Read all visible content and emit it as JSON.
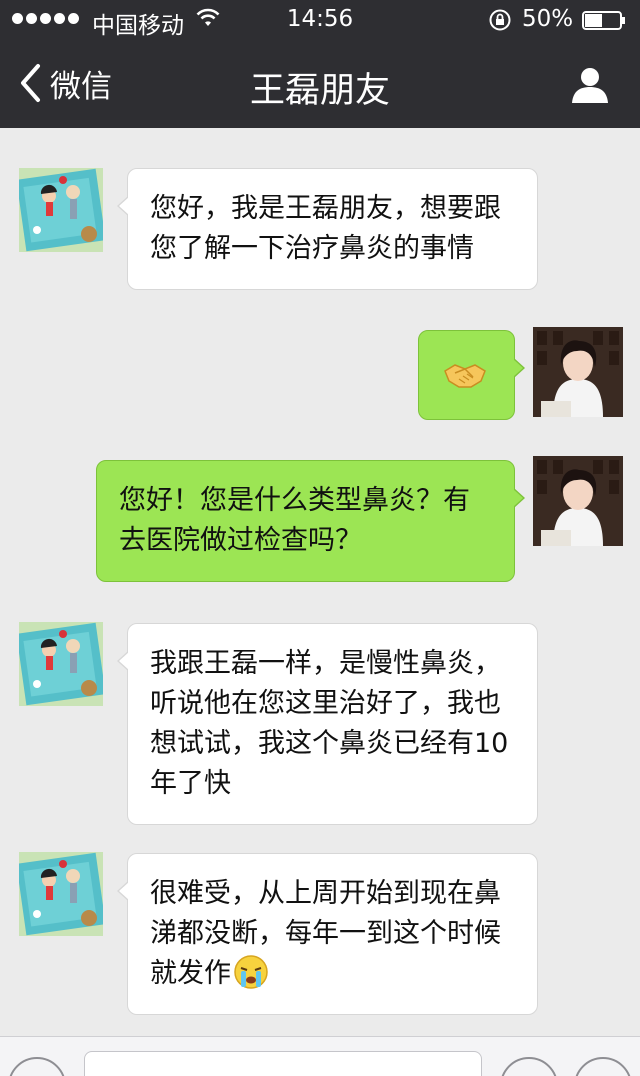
{
  "status_bar": {
    "carrier": "中国移动",
    "time": "14:56",
    "battery": "50%",
    "battery_level": 0.5
  },
  "nav": {
    "back_label": "微信",
    "title": "王磊朋友"
  },
  "messages": [
    {
      "side": "in",
      "text": "您好，我是王磊朋友，想要跟您了解一下治疗鼻炎的事情"
    },
    {
      "side": "out",
      "text": "",
      "emoji": "handshake"
    },
    {
      "side": "out",
      "text": "您好！您是什么类型鼻炎？有去医院做过检查吗？"
    },
    {
      "side": "in",
      "text": "我跟王磊一样，是慢性鼻炎，听说他在您这里治好了，我也想试试，我这个鼻炎已经有10年了快"
    },
    {
      "side": "in",
      "text": "很难受，从上周开始到现在鼻涕都没断，每年一到这个时候就发作",
      "emoji": "crying-face"
    }
  ],
  "colors": {
    "header": "#2e2e32",
    "chat_bg": "#ebebeb",
    "incoming_bubble": "#ffffff",
    "outgoing_bubble": "#9ce554"
  }
}
